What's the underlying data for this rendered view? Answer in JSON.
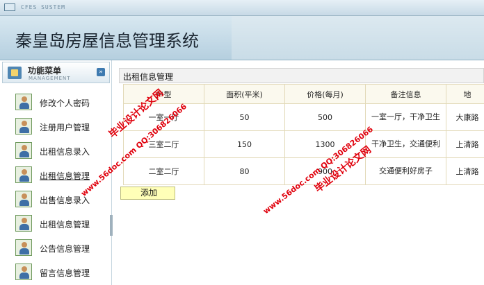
{
  "titlebar": {
    "system_text": "CFES SUSTEM"
  },
  "header": {
    "site_title": "秦皇岛房屋信息管理系统"
  },
  "sidebar": {
    "menu_title": "功能菜单",
    "menu_subtitle": "MANAGEMENT",
    "toggle_glyph": "»",
    "items": [
      {
        "label": "修改个人密码"
      },
      {
        "label": "注册用户管理"
      },
      {
        "label": "出租信息录入"
      },
      {
        "label": "出租信息管理"
      },
      {
        "label": "出售信息录入"
      },
      {
        "label": "出租信息管理"
      },
      {
        "label": "公告信息管理"
      },
      {
        "label": "留言信息管理"
      }
    ]
  },
  "content": {
    "panel_title": "出租信息管理",
    "columns": [
      "户型",
      "面积(平米)",
      "价格(每月)",
      "备注信息",
      "地"
    ],
    "rows": [
      {
        "type": "一室一厅",
        "area": "50",
        "price": "500",
        "note": "一室一厅，干净卫生",
        "address": "大康路"
      },
      {
        "type": "三室二厅",
        "area": "150",
        "price": "1300",
        "note": "干净卫生，交通便利",
        "address": "上清路"
      },
      {
        "type": "二室二厅",
        "area": "80",
        "price": "900",
        "note": "交通便利好房子",
        "address": "上清路"
      }
    ],
    "add_button": "添加"
  },
  "watermarks": [
    {
      "text": "毕业设计论文网"
    },
    {
      "text": "www.56doc.com  QQ:306826066"
    },
    {
      "text": "www.56doc.com  QQ:306826066"
    },
    {
      "text": "毕业设计论文网"
    }
  ]
}
